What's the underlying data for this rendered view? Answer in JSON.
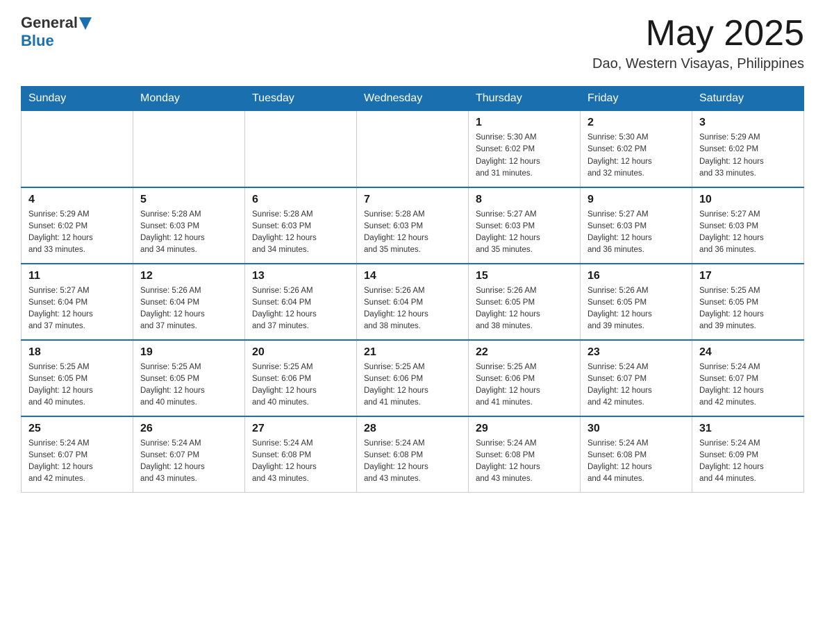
{
  "header": {
    "logo": {
      "general": "General",
      "blue": "Blue"
    },
    "month_year": "May 2025",
    "location": "Dao, Western Visayas, Philippines"
  },
  "weekdays": [
    "Sunday",
    "Monday",
    "Tuesday",
    "Wednesday",
    "Thursday",
    "Friday",
    "Saturday"
  ],
  "weeks": [
    [
      {
        "day": "",
        "info": ""
      },
      {
        "day": "",
        "info": ""
      },
      {
        "day": "",
        "info": ""
      },
      {
        "day": "",
        "info": ""
      },
      {
        "day": "1",
        "info": "Sunrise: 5:30 AM\nSunset: 6:02 PM\nDaylight: 12 hours\nand 31 minutes."
      },
      {
        "day": "2",
        "info": "Sunrise: 5:30 AM\nSunset: 6:02 PM\nDaylight: 12 hours\nand 32 minutes."
      },
      {
        "day": "3",
        "info": "Sunrise: 5:29 AM\nSunset: 6:02 PM\nDaylight: 12 hours\nand 33 minutes."
      }
    ],
    [
      {
        "day": "4",
        "info": "Sunrise: 5:29 AM\nSunset: 6:02 PM\nDaylight: 12 hours\nand 33 minutes."
      },
      {
        "day": "5",
        "info": "Sunrise: 5:28 AM\nSunset: 6:03 PM\nDaylight: 12 hours\nand 34 minutes."
      },
      {
        "day": "6",
        "info": "Sunrise: 5:28 AM\nSunset: 6:03 PM\nDaylight: 12 hours\nand 34 minutes."
      },
      {
        "day": "7",
        "info": "Sunrise: 5:28 AM\nSunset: 6:03 PM\nDaylight: 12 hours\nand 35 minutes."
      },
      {
        "day": "8",
        "info": "Sunrise: 5:27 AM\nSunset: 6:03 PM\nDaylight: 12 hours\nand 35 minutes."
      },
      {
        "day": "9",
        "info": "Sunrise: 5:27 AM\nSunset: 6:03 PM\nDaylight: 12 hours\nand 36 minutes."
      },
      {
        "day": "10",
        "info": "Sunrise: 5:27 AM\nSunset: 6:03 PM\nDaylight: 12 hours\nand 36 minutes."
      }
    ],
    [
      {
        "day": "11",
        "info": "Sunrise: 5:27 AM\nSunset: 6:04 PM\nDaylight: 12 hours\nand 37 minutes."
      },
      {
        "day": "12",
        "info": "Sunrise: 5:26 AM\nSunset: 6:04 PM\nDaylight: 12 hours\nand 37 minutes."
      },
      {
        "day": "13",
        "info": "Sunrise: 5:26 AM\nSunset: 6:04 PM\nDaylight: 12 hours\nand 37 minutes."
      },
      {
        "day": "14",
        "info": "Sunrise: 5:26 AM\nSunset: 6:04 PM\nDaylight: 12 hours\nand 38 minutes."
      },
      {
        "day": "15",
        "info": "Sunrise: 5:26 AM\nSunset: 6:05 PM\nDaylight: 12 hours\nand 38 minutes."
      },
      {
        "day": "16",
        "info": "Sunrise: 5:26 AM\nSunset: 6:05 PM\nDaylight: 12 hours\nand 39 minutes."
      },
      {
        "day": "17",
        "info": "Sunrise: 5:25 AM\nSunset: 6:05 PM\nDaylight: 12 hours\nand 39 minutes."
      }
    ],
    [
      {
        "day": "18",
        "info": "Sunrise: 5:25 AM\nSunset: 6:05 PM\nDaylight: 12 hours\nand 40 minutes."
      },
      {
        "day": "19",
        "info": "Sunrise: 5:25 AM\nSunset: 6:05 PM\nDaylight: 12 hours\nand 40 minutes."
      },
      {
        "day": "20",
        "info": "Sunrise: 5:25 AM\nSunset: 6:06 PM\nDaylight: 12 hours\nand 40 minutes."
      },
      {
        "day": "21",
        "info": "Sunrise: 5:25 AM\nSunset: 6:06 PM\nDaylight: 12 hours\nand 41 minutes."
      },
      {
        "day": "22",
        "info": "Sunrise: 5:25 AM\nSunset: 6:06 PM\nDaylight: 12 hours\nand 41 minutes."
      },
      {
        "day": "23",
        "info": "Sunrise: 5:24 AM\nSunset: 6:07 PM\nDaylight: 12 hours\nand 42 minutes."
      },
      {
        "day": "24",
        "info": "Sunrise: 5:24 AM\nSunset: 6:07 PM\nDaylight: 12 hours\nand 42 minutes."
      }
    ],
    [
      {
        "day": "25",
        "info": "Sunrise: 5:24 AM\nSunset: 6:07 PM\nDaylight: 12 hours\nand 42 minutes."
      },
      {
        "day": "26",
        "info": "Sunrise: 5:24 AM\nSunset: 6:07 PM\nDaylight: 12 hours\nand 43 minutes."
      },
      {
        "day": "27",
        "info": "Sunrise: 5:24 AM\nSunset: 6:08 PM\nDaylight: 12 hours\nand 43 minutes."
      },
      {
        "day": "28",
        "info": "Sunrise: 5:24 AM\nSunset: 6:08 PM\nDaylight: 12 hours\nand 43 minutes."
      },
      {
        "day": "29",
        "info": "Sunrise: 5:24 AM\nSunset: 6:08 PM\nDaylight: 12 hours\nand 43 minutes."
      },
      {
        "day": "30",
        "info": "Sunrise: 5:24 AM\nSunset: 6:08 PM\nDaylight: 12 hours\nand 44 minutes."
      },
      {
        "day": "31",
        "info": "Sunrise: 5:24 AM\nSunset: 6:09 PM\nDaylight: 12 hours\nand 44 minutes."
      }
    ]
  ]
}
